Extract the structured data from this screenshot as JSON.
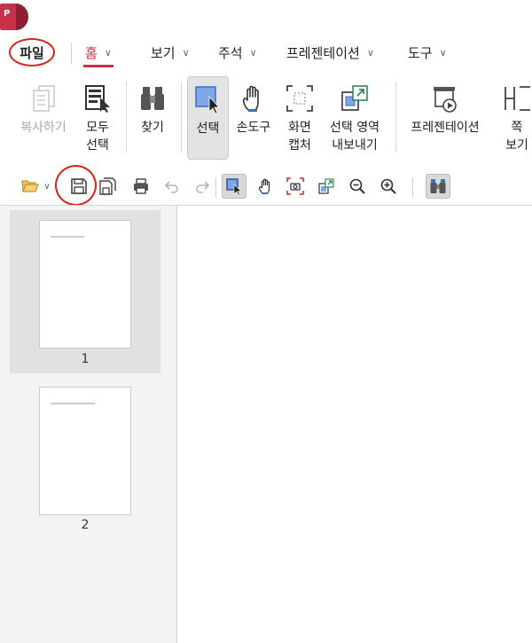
{
  "menu": {
    "file": "파일",
    "tabs": [
      {
        "label": "홈"
      },
      {
        "label": "보기"
      },
      {
        "label": "주석"
      },
      {
        "label": "프레젠테이션"
      },
      {
        "label": "도구"
      }
    ]
  },
  "ribbon": {
    "copy": "복사하기",
    "select_all_1": "모두",
    "select_all_2": "선택",
    "find": "찾기",
    "select": "선택",
    "hand": "손도구",
    "capture_1": "화면",
    "capture_2": "캡처",
    "export_1": "선택 영역",
    "export_2": "내보내기",
    "presentation": "프레젠테이션",
    "page_view_1": "쪽",
    "page_view_2": "보기"
  },
  "thumbnails": [
    {
      "number": "1"
    },
    {
      "number": "2"
    }
  ],
  "colors": {
    "accent": "#c8304a",
    "annotation_circle": "#d9261c",
    "logo": "#c8304a"
  }
}
